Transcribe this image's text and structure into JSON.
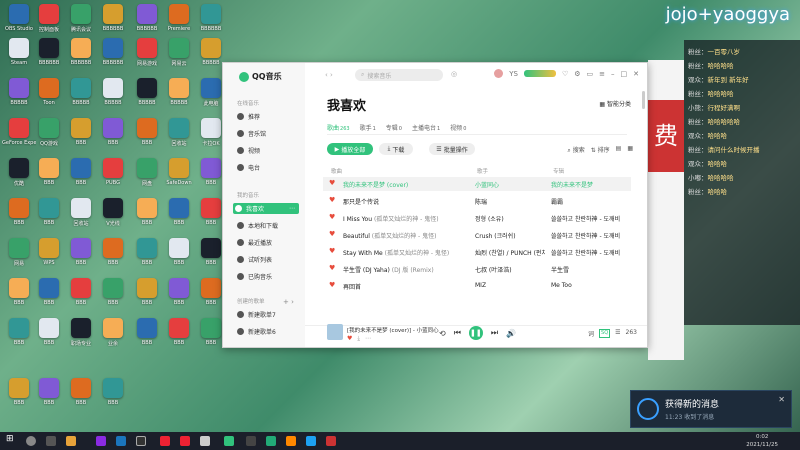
{
  "desktop": {
    "icons": [
      "OBS Studio",
      "控制面板",
      "腾讯会议",
      "BBBBBB",
      "BBBBBB",
      "Premiere",
      "BBBBBB",
      "Steam",
      "BBBBBB",
      "BBBBBB",
      "BBBBBB",
      "网易游戏",
      "网易云",
      "BBBBB",
      "BBBBB",
      "Toon",
      "BBBBB",
      "BBBBB",
      "BBBBB",
      "BBBBB",
      "此电脑",
      "GeForce Experience",
      "QQ游戏",
      "BBB",
      "BBB",
      "BBB",
      "回收站",
      "卡拉OK",
      "优酷",
      "BBB",
      "BBB",
      "PUBG",
      "网盘",
      "SafeDown",
      "BBB",
      "BBB",
      "BBB",
      "回收站",
      "V光线",
      "BBB",
      "BBB",
      "BBB",
      "网易",
      "WPS",
      "BBB",
      "BBB",
      "BBB",
      "BBB",
      "BBB",
      "BBB",
      "BBB",
      "BBB",
      "BBB",
      "BBB",
      "BBB",
      "BBB",
      "BBB",
      "BBB",
      "职场专业",
      "业余",
      "BBB",
      "BBB",
      "BBB",
      "BBB",
      "BBB",
      "BBB",
      "BBB"
    ]
  },
  "overlay": {
    "title": "jojo+yaoggya",
    "chat": [
      {
        "user": "粉丝",
        "msg": "一百零八岁"
      },
      {
        "user": "粉丝",
        "msg": "哈哈哈哈"
      },
      {
        "user": "观众",
        "msg": "新年到 新年好"
      },
      {
        "user": "粉丝",
        "msg": "哈哈哈哈"
      },
      {
        "user": "小熊",
        "msg": "行程好满啊"
      },
      {
        "user": "粉丝",
        "msg": "哈哈哈哈哈"
      },
      {
        "user": "观众",
        "msg": "哈哈哈"
      },
      {
        "user": "粉丝",
        "msg": "请问什么时候开播"
      },
      {
        "user": "观众",
        "msg": "哈哈哈"
      },
      {
        "user": "小嘟",
        "msg": "哈哈哈哈"
      },
      {
        "user": "粉丝",
        "msg": "哈哈哈"
      }
    ]
  },
  "qq": {
    "logo": "QQ音乐",
    "side": {
      "online_label": "在线音乐",
      "online": [
        "推荐",
        "音乐馆",
        "视频",
        "电台"
      ],
      "my_label": "我的音乐",
      "my": [
        "我喜欢",
        "本地和下载",
        "最近播放",
        "试听列表",
        "已购音乐"
      ],
      "created_label": "创建的歌单",
      "created": [
        "新建歌单7",
        "新建歌单6"
      ]
    },
    "search_placeholder": "搜索音乐",
    "user": "YS",
    "title": "我喜欢",
    "smart_play": "智能分类",
    "tabs": [
      {
        "label": "歌曲",
        "count": "263"
      },
      {
        "label": "歌手",
        "count": "1"
      },
      {
        "label": "专辑",
        "count": "0"
      },
      {
        "label": "主播电台",
        "count": "1"
      },
      {
        "label": "视频",
        "count": "0"
      }
    ],
    "buttons": {
      "play_all": "播放全部",
      "download": "下载",
      "batch": "批量操作"
    },
    "tools": {
      "search": "搜索",
      "sort": "排序"
    },
    "header": {
      "title": "歌曲",
      "singer": "歌手",
      "album": "专辑"
    },
    "songs": [
      {
        "title": "我的未来不是梦 (cover)",
        "sub": "",
        "singer": "小蓝同心",
        "album": "我的未来不是梦"
      },
      {
        "title": "那只是个传说",
        "sub": "",
        "singer": "陈瑞",
        "album": "霸霸"
      },
      {
        "title": "I Miss You",
        "sub": "(孤单又灿烂的神 - 鬼怪)",
        "singer": "정형 (소유)",
        "album": "쓸쓸하고 찬란하神 - 도깨비"
      },
      {
        "title": "Beautiful",
        "sub": "(孤单又灿烂的神 - 鬼怪)",
        "singer": "Crush (크러쉬)",
        "album": "쓸쓸하고 찬란하神 - 도깨비"
      },
      {
        "title": "Stay With Me",
        "sub": "(孤单又灿烂的神 - 鬼怪)",
        "singer": "灿烈 (찬열) / PUNCH (펀치)",
        "album": "쓸쓸하고 찬란하神 - 도깨비"
      },
      {
        "title": "半生雪 (DJ Yaha)",
        "sub": "(DJ 版 (Remix)",
        "singer": "七叔 (叶泽浩)",
        "album": "半生雪"
      },
      {
        "title": "再回首",
        "sub": "",
        "singer": "MIZ",
        "album": "Me Too"
      }
    ],
    "player": {
      "title": "[我的未来不是梦 (cover)] - 小蓝同心",
      "count": "263"
    }
  },
  "notification": {
    "title": "获得新的消息",
    "subtitle": "11:23 收到了消息"
  },
  "taskbar": {
    "time": "0:02",
    "date": "2021/11/25"
  }
}
